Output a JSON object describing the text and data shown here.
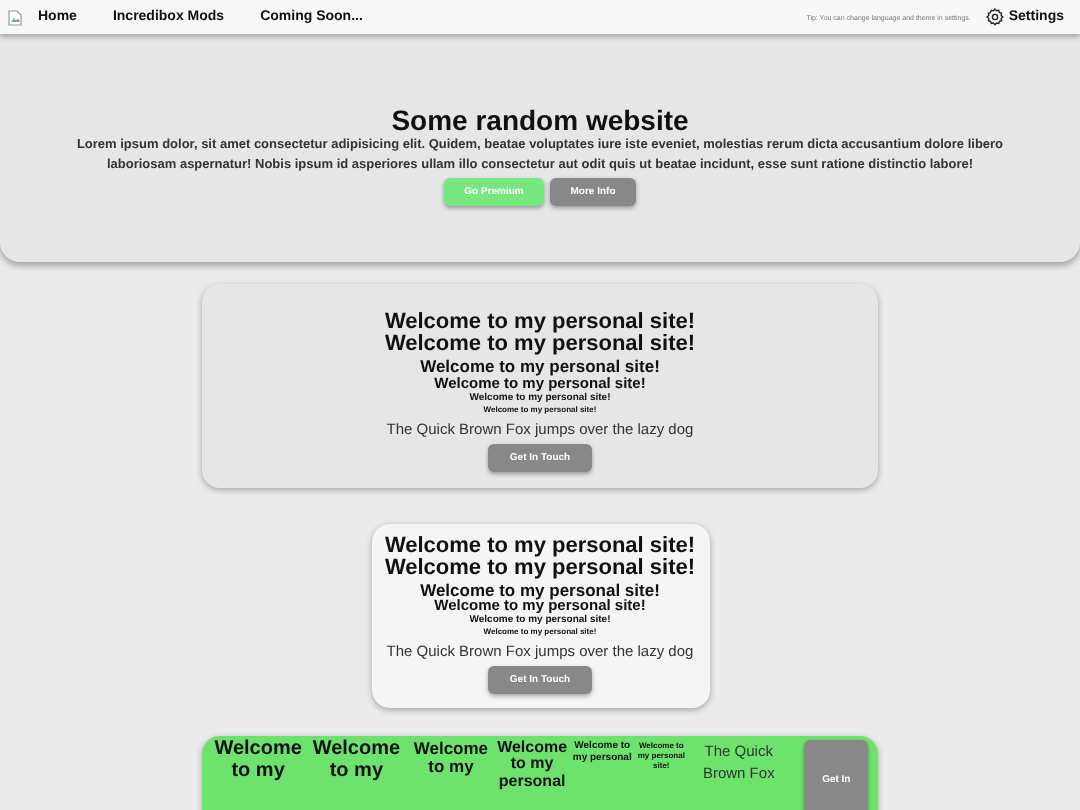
{
  "nav": {
    "items": [
      "Home",
      "Incredibox Mods",
      "Coming Soon..."
    ],
    "tip": "Tip: You can change language and theme in settings.",
    "settings": "Settings"
  },
  "hero": {
    "title": "Some random website",
    "text": "Lorem ipsum dolor, sit amet consectetur adipisicing elit. Quidem, beatae voluptates iure iste eveniet, molestias rerum dicta accusantium dolore libero laboriosam aspernatur! Nobis ipsum id asperiores ullam illo consectetur aut odit quis ut beatae incidunt, esse sunt ratione distinctio labore!",
    "buttons": [
      {
        "label": "Go Premium",
        "kind": "premium"
      },
      {
        "label": "More Info",
        "kind": "info"
      }
    ]
  },
  "cards": [
    {
      "kind": "wide",
      "headings": [
        "Welcome to my personal site!",
        "Welcome to my personal site!",
        "Welcome to my personal site!",
        "Welcome to my personal site!",
        "Welcome to my personal site!",
        "Welcome to my personal site!"
      ],
      "text": "The Quick Brown Fox jumps over the lazy dog",
      "button": "Get In Touch"
    },
    {
      "kind": "light",
      "headings": [
        "Welcome to my personal site!",
        "Welcome to my personal site!",
        "Welcome to my personal site!",
        "Welcome to my personal site!",
        "Welcome to my personal site!",
        "Welcome to my personal site!"
      ],
      "text": "The Quick Brown Fox jumps over the lazy dog",
      "button": "Get In Touch"
    },
    {
      "kind": "row",
      "headings": [
        "Welcome to my",
        "Welcome to my",
        "Welcome to my",
        "Welcome to my personal",
        "Welcome to my personal",
        "Welcome to my personal site!"
      ],
      "text": "The Quick Brown Fox",
      "button": "Get In"
    }
  ]
}
